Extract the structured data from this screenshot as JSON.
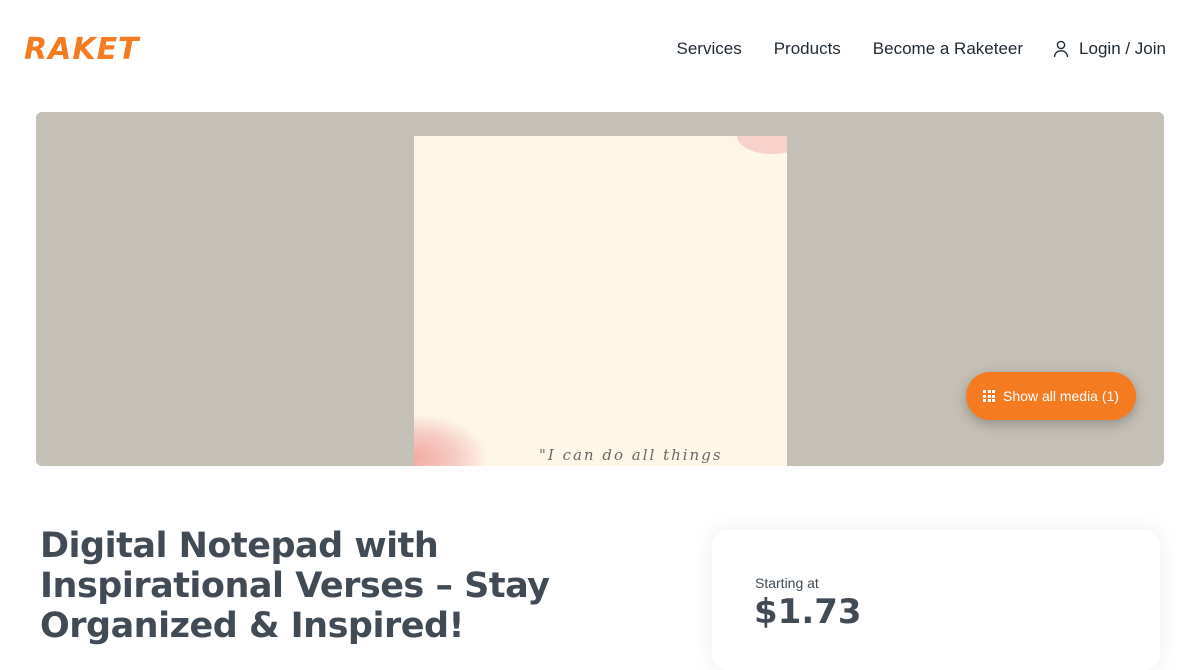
{
  "brand": {
    "logo": "RAKET",
    "accent": "#f47b20"
  },
  "nav": {
    "items": [
      "Services",
      "Products",
      "Become a Raketeer"
    ],
    "login": "Login / Join"
  },
  "hero": {
    "verse_text": "\"I can do all things through",
    "show_media_label": "Show all media (1)"
  },
  "product": {
    "title": "Digital Notepad with Inspirational Verses – Stay Organized & Inspired!"
  },
  "pricing": {
    "label": "Starting at",
    "price": "$1.73"
  }
}
